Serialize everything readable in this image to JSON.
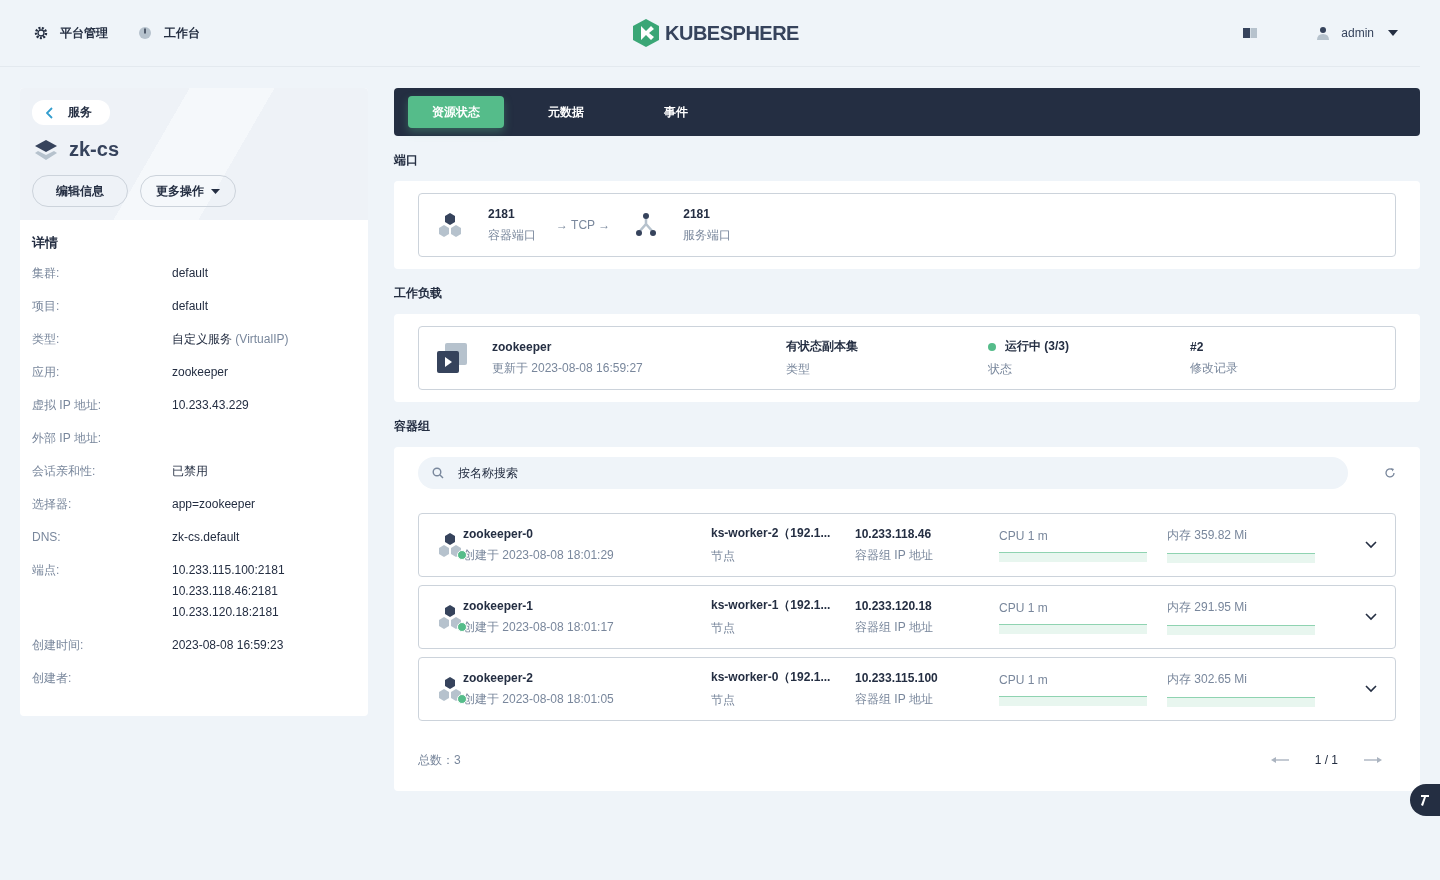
{
  "header": {
    "nav": [
      {
        "kind": "gear",
        "label": "平台管理"
      },
      {
        "kind": "dial",
        "label": "工作台"
      }
    ],
    "logo": "KUBESPHERE",
    "user": "admin"
  },
  "service": {
    "back": "服务",
    "name": "zk-cs",
    "buttons": [
      {
        "label": "编辑信息",
        "caret": false
      },
      {
        "label": "更多操作",
        "caret": true
      }
    ]
  },
  "details": {
    "title": "详情",
    "rows": [
      {
        "label": "集群:",
        "values": [
          "default"
        ]
      },
      {
        "label": "项目:",
        "values": [
          "default"
        ]
      },
      {
        "label": "类型:",
        "values": [
          "自定义服务"
        ],
        "note": "(VirtualIP)"
      },
      {
        "label": "应用:",
        "values": [
          "zookeeper"
        ]
      },
      {
        "label": "虚拟 IP 地址:",
        "values": [
          "10.233.43.229"
        ]
      },
      {
        "label": "外部 IP 地址:"
      },
      {
        "label": "会话亲和性:",
        "values": [
          "已禁用"
        ]
      },
      {
        "label": "选择器:",
        "values": [
          "app=zookeeper"
        ]
      },
      {
        "label": "DNS:",
        "values": [
          "zk-cs.default"
        ]
      },
      {
        "label": "端点:",
        "values": [
          "10.233.115.100:2181",
          "10.233.118.46:2181",
          "10.233.120.18:2181"
        ]
      },
      {
        "label": "创建时间:",
        "values": [
          "2023-08-08 16:59:23"
        ]
      },
      {
        "label": "创建者:"
      }
    ]
  },
  "tabs": [
    {
      "label": "资源状态",
      "selected": true
    },
    {
      "label": "元数据",
      "selected": false
    },
    {
      "label": "事件",
      "selected": false
    }
  ],
  "ports": {
    "title": "端口",
    "container_port": "2181",
    "container_label": "容器端口",
    "protocol": "→ TCP →",
    "service_port": "2181",
    "service_label": "服务端口"
  },
  "workload": {
    "title": "工作负载",
    "name": "zookeeper",
    "updated": "更新于 2023-08-08 16:59:27",
    "type": "有状态副本集",
    "type_label": "类型",
    "status": "运行中 (3/3)",
    "color": "#55bc8a",
    "status_label": "状态",
    "revision": "#2",
    "revision_label": "修改记录"
  },
  "pods": {
    "title": "容器组",
    "search_placeholder": "按名称搜索",
    "items": [
      {
        "name": "zookeeper-0",
        "created": "创建于 2023-08-08 18:01:29",
        "node": "ks-worker-2（192.1...",
        "node_label": "节点",
        "ip": "10.233.118.46",
        "ip_label": "容器组 IP 地址",
        "cpu": "CPU 1 m",
        "memory": "内存 359.82 Mi",
        "color": "#55bc8a"
      },
      {
        "name": "zookeeper-1",
        "created": "创建于 2023-08-08 18:01:17",
        "node": "ks-worker-1（192.1...",
        "node_label": "节点",
        "ip": "10.233.120.18",
        "ip_label": "容器组 IP 地址",
        "cpu": "CPU 1 m",
        "memory": "内存 291.95 Mi",
        "color": "#55bc8a"
      },
      {
        "name": "zookeeper-2",
        "created": "创建于 2023-08-08 18:01:05",
        "node": "ks-worker-0（192.1...",
        "node_label": "节点",
        "ip": "10.233.115.100",
        "ip_label": "容器组 IP 地址",
        "cpu": "CPU 1 m",
        "memory": "内存 302.65 Mi",
        "color": "#55bc8a"
      }
    ],
    "total": "总数：3",
    "page": "1 / 1"
  }
}
